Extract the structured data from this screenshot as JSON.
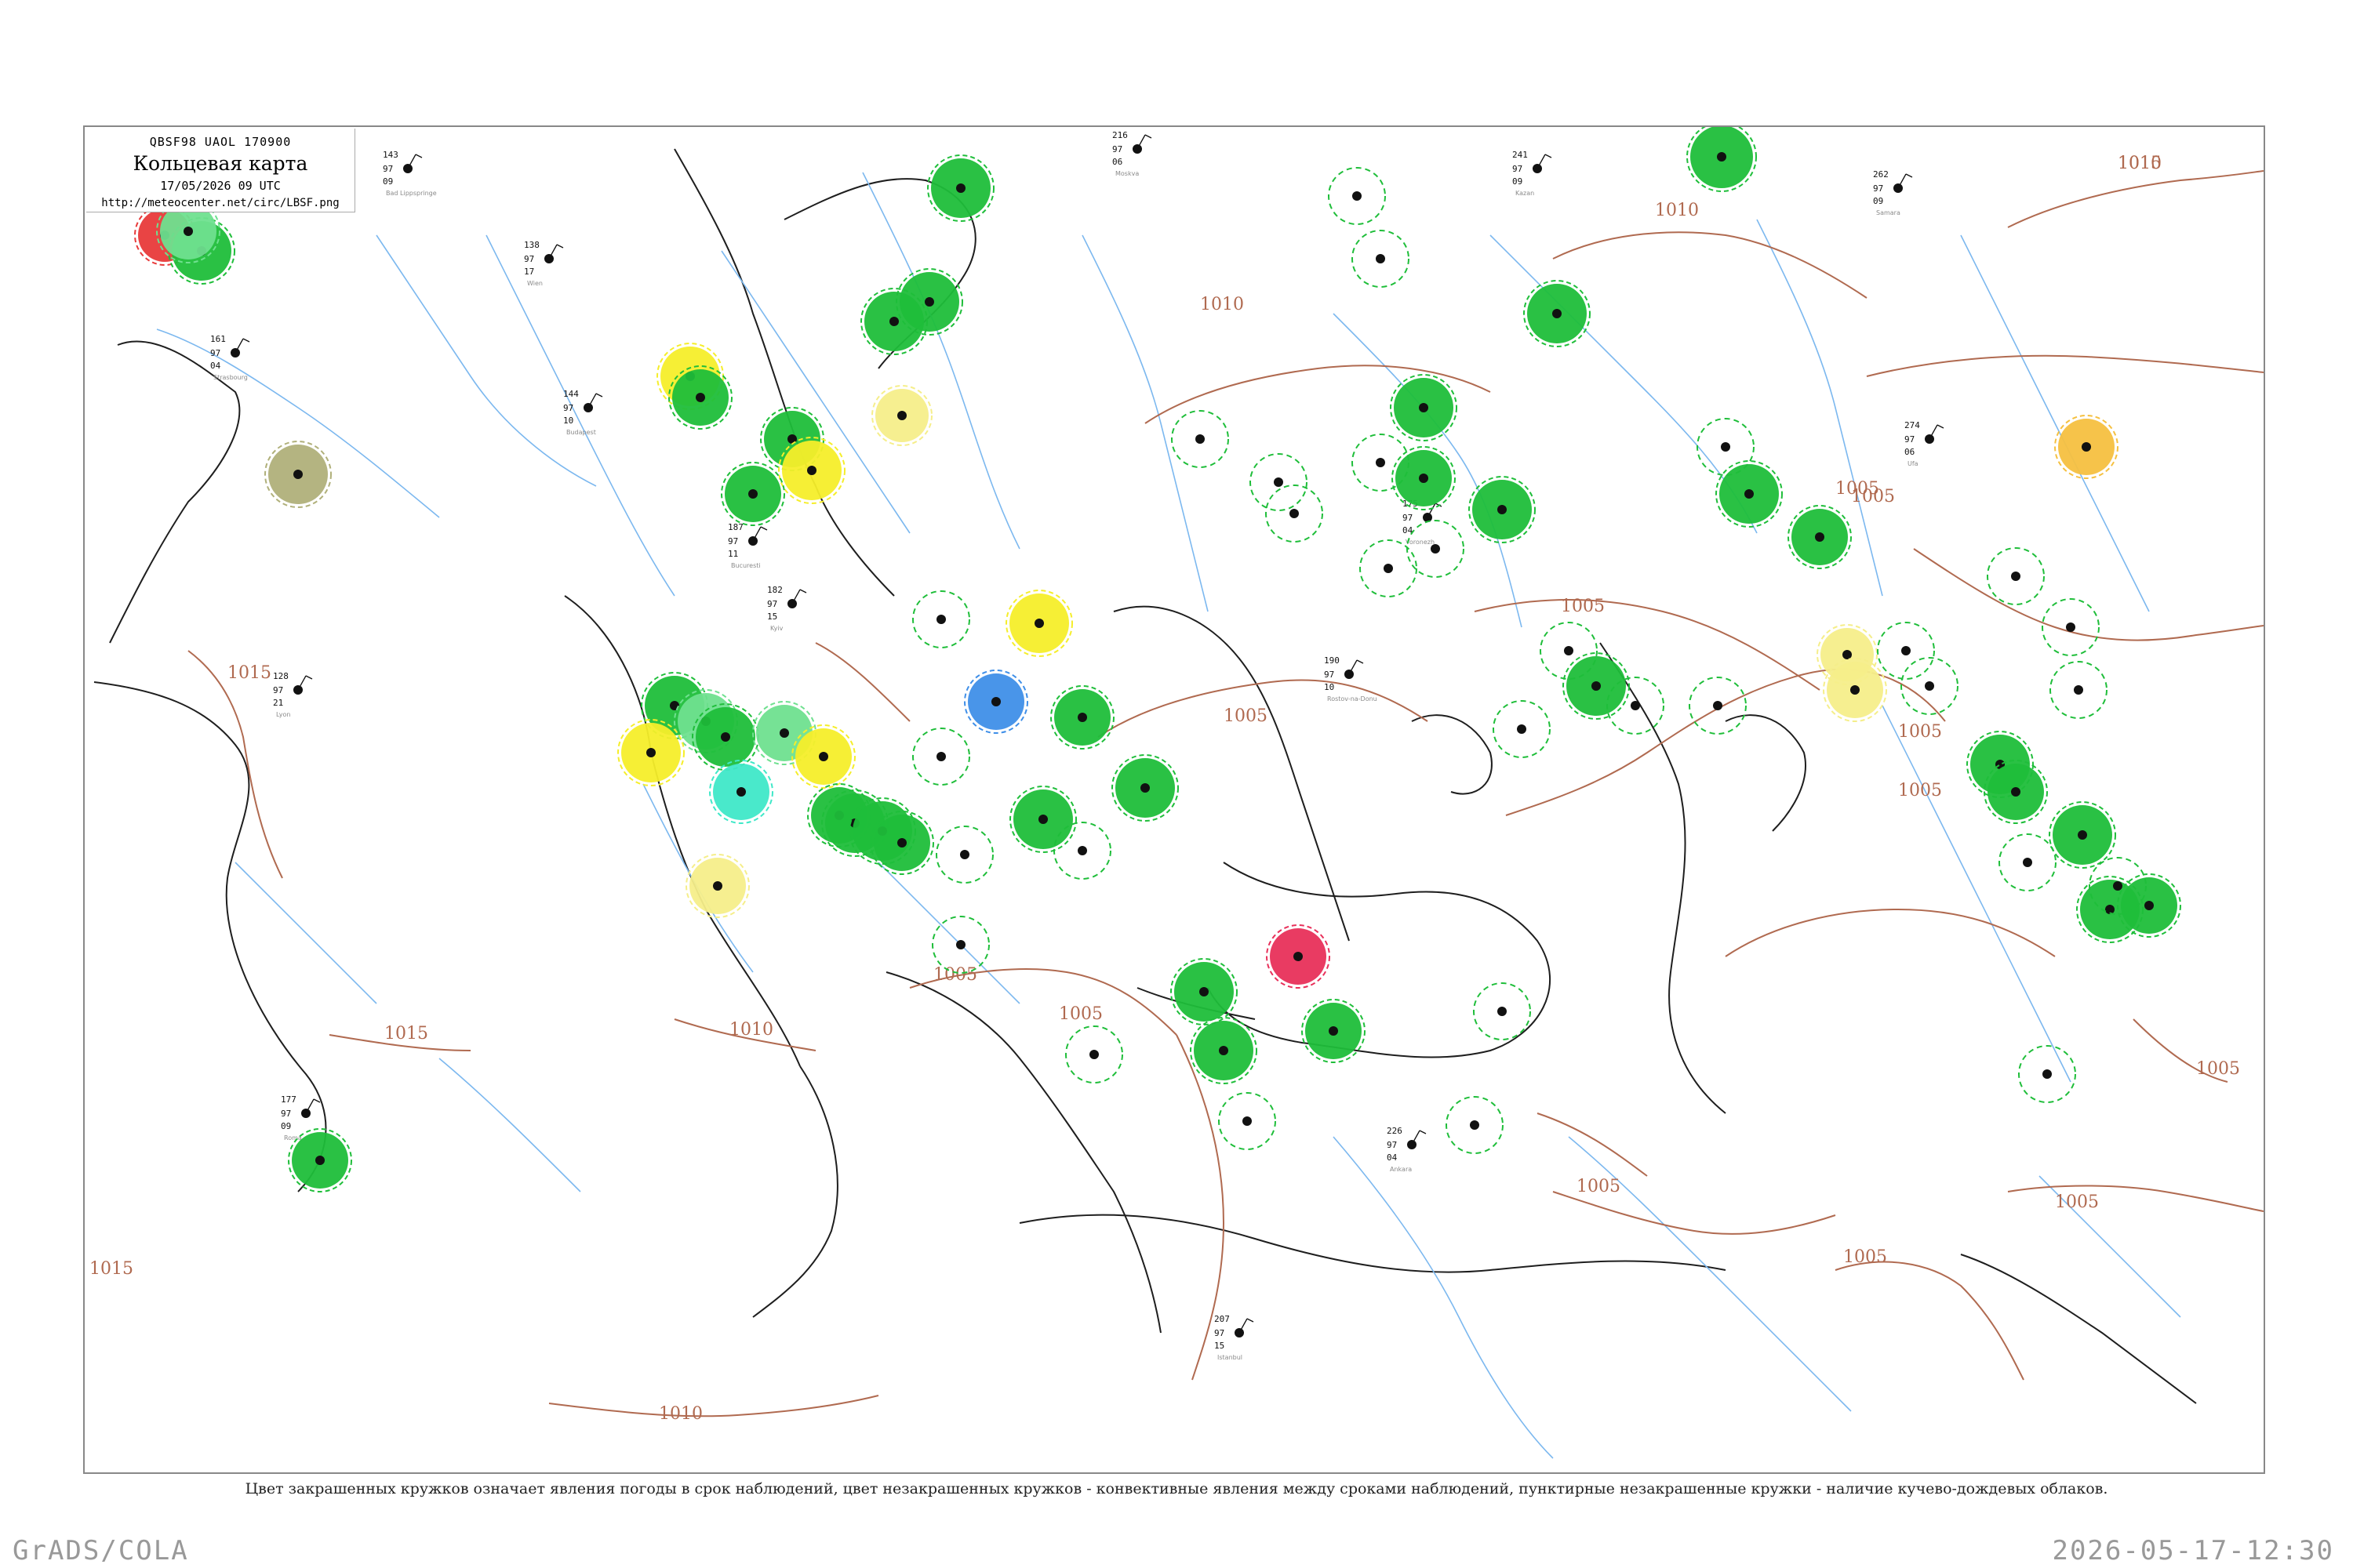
{
  "header": {
    "code_line": "QBSF98  UAOL  170900",
    "title": "Кольцевая карта",
    "datetime": "17/05/2026 09 UTC",
    "url": "http://meteocenter.net/circ/LBSF.png"
  },
  "isobar_labels": [
    {
      "text": "1015",
      "pos": "north-east"
    },
    {
      "text": "1010",
      "pos": "north-east"
    },
    {
      "text": "1010",
      "pos": "north-center"
    },
    {
      "text": "1010",
      "pos": "north-center-2"
    },
    {
      "text": "1015",
      "pos": "west"
    },
    {
      "text": "1015",
      "pos": "south-west"
    },
    {
      "text": "1010",
      "pos": "south-center-west"
    },
    {
      "text": "1005",
      "pos": "south-center"
    },
    {
      "text": "1005",
      "pos": "south-center-2"
    },
    {
      "text": "1005",
      "pos": "center-east"
    },
    {
      "text": "1005",
      "pos": "east"
    },
    {
      "text": "1005",
      "pos": "east-2"
    },
    {
      "text": "1005",
      "pos": "far-east"
    },
    {
      "text": "1005",
      "pos": "south-east"
    },
    {
      "text": "1005",
      "pos": "south-east-2"
    },
    {
      "text": "1005",
      "pos": "south-east-3"
    },
    {
      "text": "1005",
      "pos": "south"
    },
    {
      "text": "1010",
      "pos": "bottom"
    },
    {
      "text": "1015",
      "pos": "bottom-left-edge"
    },
    {
      "text": "1005",
      "pos": "center"
    },
    {
      "text": "1005",
      "pos": "north-east-2"
    }
  ],
  "weather_circles": [
    {
      "color": "#e83a3a",
      "kind": "filled"
    },
    {
      "color": "#1fbe3a",
      "kind": "filled"
    },
    {
      "color": "#6fe08f",
      "kind": "filled"
    },
    {
      "color": "#f5ee2a",
      "kind": "filled"
    },
    {
      "color": "#b0b07a",
      "kind": "filled"
    },
    {
      "color": "#3f8fe8",
      "kind": "filled"
    },
    {
      "color": "#3fe8c8",
      "kind": "filled"
    },
    {
      "color": "#f5c040",
      "kind": "filled"
    },
    {
      "color": "#e8305a",
      "kind": "filled"
    },
    {
      "color": "#f5ee8a",
      "kind": "filled"
    },
    {
      "color": "#1fbe3a",
      "kind": "dashed"
    }
  ],
  "station_samples": [
    {
      "top": "143",
      "mid": "97",
      "bot": "09",
      "name": "Bad Lippspringe"
    },
    {
      "top": "161",
      "mid": "97",
      "bot": "04",
      "name": "Strasbourg"
    },
    {
      "top": "138",
      "mid": "97",
      "bot": "17",
      "name": "Wien"
    },
    {
      "top": "144",
      "mid": "97",
      "bot": "10",
      "name": "Budapest"
    },
    {
      "top": "187",
      "mid": "97",
      "bot": "11",
      "name": "Bucuresti"
    },
    {
      "top": "182",
      "mid": "97",
      "bot": "15",
      "name": "Kyiv"
    },
    {
      "top": "216",
      "mid": "97",
      "bot": "06",
      "name": "Moskva"
    },
    {
      "top": "175",
      "mid": "97",
      "bot": "04",
      "name": "Voronezh"
    },
    {
      "top": "190",
      "mid": "97",
      "bot": "10",
      "name": "Rostov-na-Donu"
    },
    {
      "top": "226",
      "mid": "97",
      "bot": "04",
      "name": "Ankara"
    },
    {
      "top": "207",
      "mid": "97",
      "bot": "15",
      "name": "Istanbul"
    },
    {
      "top": "262",
      "mid": "97",
      "bot": "09",
      "name": "Samara"
    },
    {
      "top": "274",
      "mid": "97",
      "bot": "06",
      "name": "Ufa"
    },
    {
      "top": "128",
      "mid": "97",
      "bot": "21",
      "name": "Lyon"
    },
    {
      "top": "177",
      "mid": "97",
      "bot": "09",
      "name": "Roma"
    },
    {
      "top": "241",
      "mid": "97",
      "bot": "09",
      "name": "Kazan"
    }
  ],
  "footnote": "Цвет закрашенных кружков означает явления погоды в срок наблюдений, цвет незакрашенных кружков - конвективные явления между сроками наблюдений, пунктирные незакрашенные кружки - наличие кучево-дождевых облаков.",
  "footer": {
    "left": "GrADS/COLA",
    "right": "2026-05-17-12:30"
  }
}
